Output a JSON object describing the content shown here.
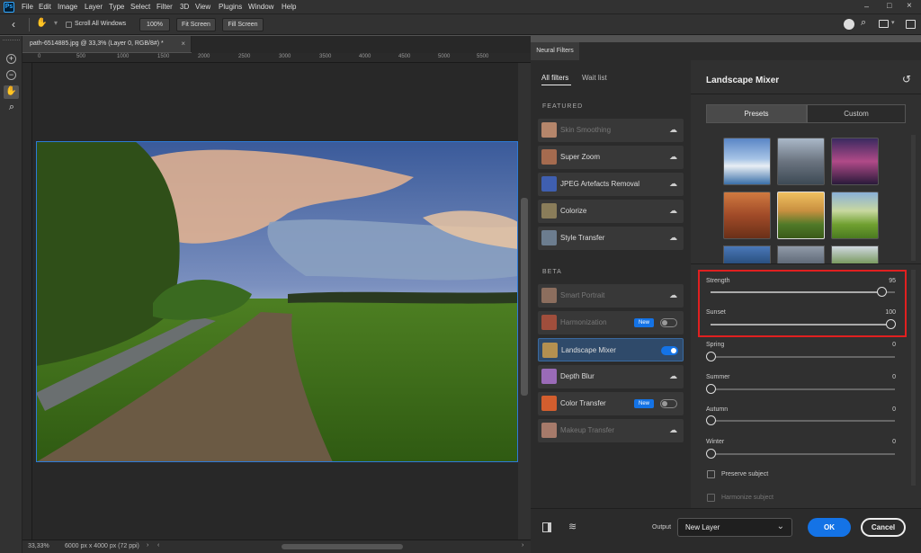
{
  "app": {
    "logo": "Ps"
  },
  "menu": [
    "File",
    "Edit",
    "Image",
    "Layer",
    "Type",
    "Select",
    "Filter",
    "3D",
    "View",
    "Plugins",
    "Window",
    "Help"
  ],
  "options": {
    "scroll_all": "Scroll All Windows",
    "zoom": "100%",
    "fit_screen": "Fit Screen",
    "fill_screen": "Fill Screen"
  },
  "document": {
    "tab_title": "path-6514885.jpg @ 33,3% (Layer 0, RGB/8#) *",
    "zoom_status": "33,33%",
    "size_status": "6000 px x 4000 px (72 ppi)",
    "ruler_ticks": [
      "0",
      "500",
      "1000",
      "1500",
      "2000",
      "2500",
      "3000",
      "3500",
      "4000",
      "4500",
      "5000",
      "5500"
    ]
  },
  "neural": {
    "panel_tab": "Neural Filters",
    "tabs": {
      "all": "All filters",
      "wait": "Wait list"
    },
    "featured_heading": "FEATURED",
    "beta_heading": "BETA",
    "featured": [
      {
        "label": "Skin Smoothing",
        "dim": true,
        "thumb": "#b5866b"
      },
      {
        "label": "Super Zoom",
        "dim": false,
        "thumb": "#a56b4f"
      },
      {
        "label": "JPEG Artefacts Removal",
        "dim": false,
        "thumb": "#3f5fb0"
      },
      {
        "label": "Colorize",
        "dim": false,
        "thumb": "#8a7d5a"
      },
      {
        "label": "Style Transfer",
        "dim": false,
        "thumb": "#6c7d8f"
      }
    ],
    "beta": [
      {
        "label": "Smart Portrait",
        "dim": true,
        "thumb": "#8c6e5e"
      },
      {
        "label": "Harmonization",
        "dim": true,
        "thumb": "#a04e3c",
        "badge": "New"
      },
      {
        "label": "Landscape Mixer",
        "dim": false,
        "thumb": "#b49050"
      },
      {
        "label": "Depth Blur",
        "dim": false,
        "thumb": "#9a6bb8"
      },
      {
        "label": "Color Transfer",
        "dim": false,
        "thumb": "#d35e2e",
        "badge": "New"
      },
      {
        "label": "Makeup Transfer",
        "dim": true,
        "thumb": "#a67a6a"
      }
    ],
    "filter_title": "Landscape Mixer",
    "preset_tabs": {
      "presets": "Presets",
      "custom": "Custom"
    },
    "sliders": [
      {
        "label": "Strength",
        "value": "95"
      },
      {
        "label": "Sunset",
        "value": "100"
      },
      {
        "label": "Spring",
        "value": "0"
      },
      {
        "label": "Summer",
        "value": "0"
      },
      {
        "label": "Autumn",
        "value": "0"
      },
      {
        "label": "Winter",
        "value": "0"
      }
    ],
    "checks": {
      "preserve": "Preserve subject",
      "harmonize": "Harmonize subject"
    },
    "output_label": "Output",
    "output_value": "New Layer",
    "ok": "OK",
    "cancel": "Cancel"
  },
  "colors": {
    "accent": "#1473e6",
    "highlight": "#e02020"
  }
}
